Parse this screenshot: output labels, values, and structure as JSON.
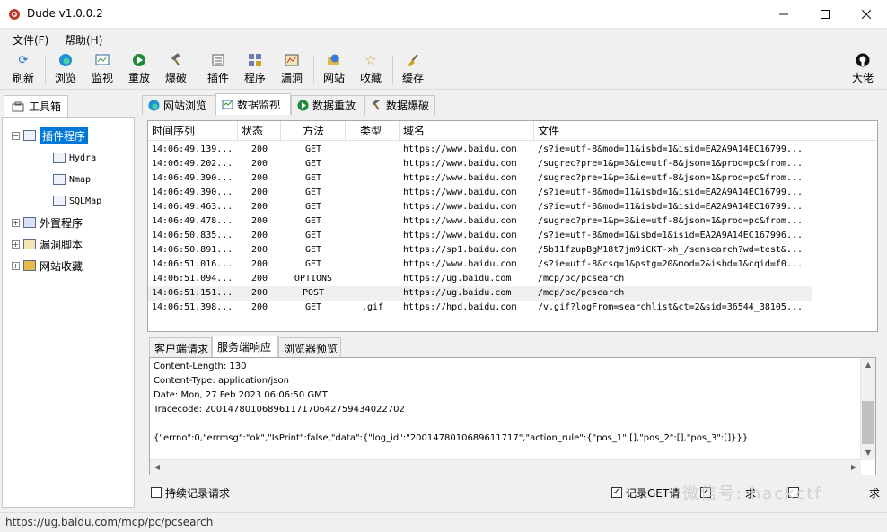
{
  "window": {
    "title": "Dude v1.0.0.2"
  },
  "menu": {
    "file": "文件(F)",
    "help": "帮助(H)"
  },
  "toolbar": {
    "refresh": "刷新",
    "browse": "浏览",
    "monitor": "监视",
    "replay": "重放",
    "bruteforce": "爆破",
    "plugins": "插件",
    "programs": "程序",
    "vulns": "漏洞",
    "sites": "网站",
    "favorites": "收藏",
    "cache": "缓存",
    "author": "大佬"
  },
  "sidebar": {
    "tab_label": "工具箱",
    "tree": {
      "plugin_programs": "插件程序",
      "hydra": "Hydra",
      "nmap": "Nmap",
      "sqlmap": "SQLMap",
      "external_programs": "外置程序",
      "vuln_scripts": "漏洞脚本",
      "site_favorites": "网站收藏"
    }
  },
  "tabs": {
    "site_browse": "网站浏览",
    "data_monitor": "数据监视",
    "data_replay": "数据重放",
    "data_bruteforce": "数据爆破"
  },
  "grid": {
    "columns": [
      "时间序列",
      "状态",
      "方法",
      "类型",
      "域名",
      "文件"
    ],
    "rows": [
      [
        "14:06:49.139...",
        "200",
        "GET",
        "",
        "https://www.baidu.com",
        "/s?ie=utf-8&mod=11&isbd=1&isid=EA2A9A14EC16799..."
      ],
      [
        "14:06:49.202...",
        "200",
        "GET",
        "",
        "https://www.baidu.com",
        "/sugrec?pre=1&p=3&ie=utf-8&json=1&prod=pc&from..."
      ],
      [
        "14:06:49.390...",
        "200",
        "GET",
        "",
        "https://www.baidu.com",
        "/sugrec?pre=1&p=3&ie=utf-8&json=1&prod=pc&from..."
      ],
      [
        "14:06:49.390...",
        "200",
        "GET",
        "",
        "https://www.baidu.com",
        "/s?ie=utf-8&mod=11&isbd=1&isid=EA2A9A14EC16799..."
      ],
      [
        "14:06:49.463...",
        "200",
        "GET",
        "",
        "https://www.baidu.com",
        "/s?ie=utf-8&mod=11&isbd=1&isid=EA2A9A14EC16799..."
      ],
      [
        "14:06:49.478...",
        "200",
        "GET",
        "",
        "https://www.baidu.com",
        "/sugrec?pre=1&p=3&ie=utf-8&json=1&prod=pc&from..."
      ],
      [
        "14:06:50.835...",
        "200",
        "GET",
        "",
        "https://www.baidu.com",
        "/s?ie=utf-8&mod=1&isbd=1&isid=EA2A9A14EC167996..."
      ],
      [
        "14:06:50.891...",
        "200",
        "GET",
        "",
        "https://sp1.baidu.com",
        "/5b11fzupBgM18t7jm9iCKT-xh_/sensearch?wd=test&..."
      ],
      [
        "14:06:51.016...",
        "200",
        "GET",
        "",
        "https://www.baidu.com",
        "/s?ie=utf-8&csq=1&pstg=20&mod=2&isbd=1&cqid=f0..."
      ],
      [
        "14:06:51.094...",
        "200",
        "OPTIONS",
        "",
        "https://ug.baidu.com",
        "/mcp/pc/pcsearch"
      ],
      [
        "14:06:51.151...",
        "200",
        "POST",
        "",
        "https://ug.baidu.com",
        "/mcp/pc/pcsearch"
      ],
      [
        "14:06:51.398...",
        "200",
        "GET",
        ".gif",
        "https://hpd.baidu.com",
        "/v.gif?logFrom=searchlist&ct=2&sid=36544_38105..."
      ]
    ]
  },
  "lower_tabs": {
    "client_request": "客户端请求",
    "server_response": "服务端响应",
    "browser_preview": "浏览器预览"
  },
  "response": {
    "lines": [
      "Content-Length: 130",
      "Content-Type: application/json",
      "Date: Mon, 27 Feb 2023 06:06:50 GMT",
      "Tracecode: 20014780106896117170642759434022702",
      "",
      "{\"errno\":0,\"errmsg\":\"ok\",\"IsPrint\":false,\"data\":{\"log_id\":\"2001478010689611717\",\"action_rule\":{\"pos_1\":[],\"pos_2\":[],\"pos_3\":[]}}}"
    ]
  },
  "options": {
    "keep_recording": "持续记录请求",
    "record_get": "记录GET请",
    "right_label_1": "求",
    "right_label_2": "求"
  },
  "status": {
    "url": "https://ug.baidu.com/mcp/pc/pcsearch"
  },
  "watermark": "微信号: hackctf"
}
